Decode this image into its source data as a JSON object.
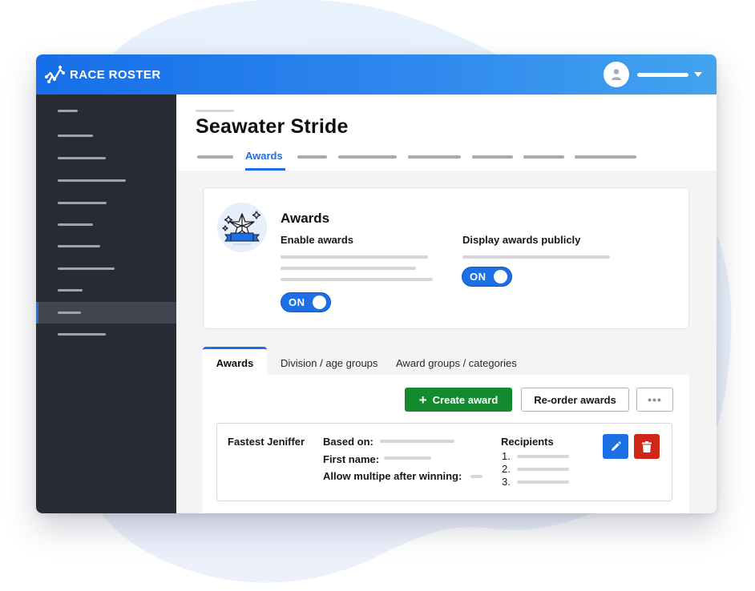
{
  "app": {
    "brand": "RACE ROSTER",
    "colors": {
      "primary": "#1d6fe5",
      "sidebar": "#282b33",
      "success": "#148a2e",
      "danger": "#d0261a"
    }
  },
  "topbar": {
    "logo_icon": "race-roster-logo-icon",
    "user_avatar_icon": "user-icon",
    "user_menu_icon": "caret-down-icon"
  },
  "sidebar": {
    "items": [
      {
        "placeholder": true,
        "active": false
      },
      {
        "placeholder": true,
        "active": false
      },
      {
        "placeholder": true,
        "active": false
      },
      {
        "placeholder": true,
        "active": false
      },
      {
        "placeholder": true,
        "active": false
      },
      {
        "placeholder": true,
        "active": false
      },
      {
        "placeholder": true,
        "active": false
      },
      {
        "placeholder": true,
        "active": false
      },
      {
        "placeholder": true,
        "active": false
      },
      {
        "placeholder": true,
        "active": true
      },
      {
        "placeholder": true,
        "active": false
      }
    ]
  },
  "header": {
    "title": "Seawater Stride",
    "active_tab": "Awards"
  },
  "awards_settings": {
    "title": "Awards",
    "badge_icon": "star-trophy-icon",
    "enable": {
      "label": "Enable awards",
      "toggle": "ON"
    },
    "display": {
      "label": "Display awards publicly",
      "toggle": "ON"
    }
  },
  "tabs": [
    {
      "label": "Awards",
      "active": true
    },
    {
      "label": "Division / age groups",
      "active": false
    },
    {
      "label": "Award groups / categories",
      "active": false
    }
  ],
  "toolbar": {
    "create_label": "Create award",
    "create_icon": "plus-icon",
    "reorder_label": "Re-order awards",
    "more_label": "•••"
  },
  "awards": [
    {
      "name": "Fastest Jeniffer",
      "fields": {
        "based_on_label": "Based on:",
        "first_name_label": "First name:",
        "allow_multiple_label": "Allow multipe after winning:"
      },
      "recipients_label": "Recipients",
      "recipient_numbers": [
        "1.",
        "2.",
        "3."
      ],
      "edit_icon": "pencil-icon",
      "delete_icon": "trash-icon"
    }
  ]
}
